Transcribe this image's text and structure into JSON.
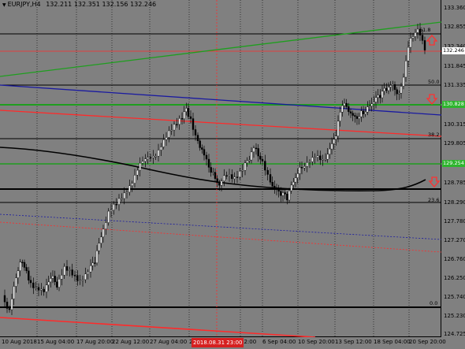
{
  "window": {
    "title": "EURJPY,H4",
    "ohlc": "132.211 132.351 132.156 132.246"
  },
  "price_axis": {
    "labels": [
      "133.360",
      "132.855",
      "132.340",
      "131.845",
      "131.335",
      "130.830",
      "130.315",
      "129.805",
      "129.295",
      "128.785",
      "128.290",
      "127.780",
      "127.270",
      "126.760",
      "126.250",
      "125.740",
      "125.230",
      "124.725"
    ]
  },
  "time_axis": {
    "labels": [
      "10 Aug 2018",
      "15 Aug 04:00",
      "17 Aug 20:00",
      "22 Aug 12:00",
      "27 Aug 04:00",
      "29",
      "12:00",
      "6 Sep 04:00",
      "10 Sep 20:00",
      "13 Sep 12:00",
      "18 Sep 04:00",
      "20 Sep 20:00"
    ],
    "crosshair_label": "2018.08.31 23:00"
  },
  "price_markers": {
    "current": "132.246",
    "green_level_1": "130.828",
    "green_level_2": "129.254"
  },
  "fibo_labels": {
    "f618": "61.8",
    "f500": "50.0",
    "f382": "38.2",
    "f236": "23.6",
    "f000": "0.0"
  },
  "colors": {
    "background": "#808080",
    "bull_candle": "#ffffff",
    "bear_candle": "#000000",
    "green_line": "#1f9e1f",
    "red_line": "#ff2a2a",
    "blue_line": "#1a1aa0",
    "arrow": "#ff3030"
  }
}
